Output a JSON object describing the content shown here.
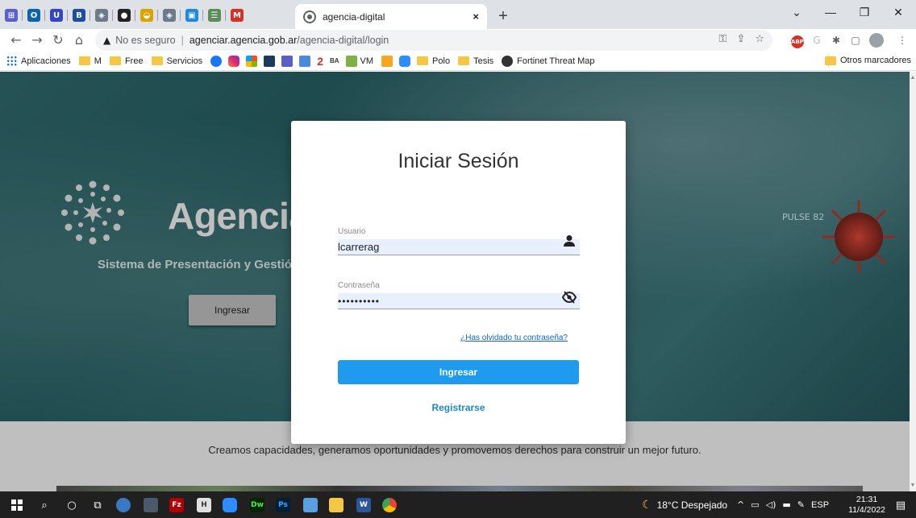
{
  "browser": {
    "active_tab": {
      "title": "agencia-digital",
      "close": "×"
    },
    "new_tab": "+",
    "address": {
      "warning": "▲",
      "security_text": "No es seguro",
      "host": "agenciar.agencia.gob.ar",
      "path": "/agencia-digital/login"
    },
    "pinned_tabs": [
      {
        "name": "teams-tab",
        "label": "⊞",
        "color": "#5b5fc7"
      },
      {
        "name": "outlook-tab",
        "label": "O",
        "color": "#0a64ad"
      },
      {
        "name": "u-tab",
        "label": "U",
        "color": "#3345c9"
      },
      {
        "name": "bank-tab",
        "label": "B",
        "color": "#1f4f9c"
      },
      {
        "name": "shield-tab-1",
        "label": "◈",
        "color": "#6c7a89"
      },
      {
        "name": "dark-tab",
        "label": "●",
        "color": "#222222"
      },
      {
        "name": "yellow-tab",
        "label": "◒",
        "color": "#d9a400"
      },
      {
        "name": "shield-tab-2",
        "label": "◈",
        "color": "#6c7a89"
      },
      {
        "name": "blue-tab",
        "label": "▣",
        "color": "#1e88e5"
      },
      {
        "name": "form-tab",
        "label": "☰",
        "color": "#5b8c5a"
      },
      {
        "name": "gmail-tab",
        "label": "M",
        "color": "#d93025"
      }
    ]
  },
  "bookmarks": {
    "apps": "Aplicaciones",
    "items": [
      {
        "name": "bookmark-m",
        "label": "M",
        "type": "folder"
      },
      {
        "name": "bookmark-free",
        "label": "Free",
        "type": "folder"
      },
      {
        "name": "bookmark-servicios",
        "label": "Servicios",
        "type": "folder"
      },
      {
        "name": "bookmark-polo",
        "label": "Polo",
        "type": "folder"
      },
      {
        "name": "bookmark-tesis",
        "label": "Tesis",
        "type": "folder"
      },
      {
        "name": "bookmark-vm",
        "label": "VM",
        "type": "icon"
      },
      {
        "name": "bookmark-fortinet",
        "label": "Fortinet Threat Map",
        "type": "icon"
      }
    ],
    "others": "Otros marcadores"
  },
  "hero": {
    "title": "Agenciar",
    "subtitle": "Sistema de Presentación y Gestión",
    "button": "Ingresar",
    "pulse": "PULSE 82"
  },
  "login": {
    "title": "Iniciar Sesión",
    "user_label": "Usuario",
    "user_value": "lcarrerag",
    "pass_label": "Contraseña",
    "pass_value": "••••••••••",
    "forgot": "¿Has olvidado tu contraseña?",
    "submit": "Ingresar",
    "register": "Registrarse"
  },
  "tagline": "Creamos capacidades, generamos oportunidades y promovemos derechos para construir un mejor futuro.",
  "taskbar": {
    "weather": "18°C Despejado",
    "lang": "ESP",
    "time": "21:31",
    "date": "11/4/2022"
  }
}
